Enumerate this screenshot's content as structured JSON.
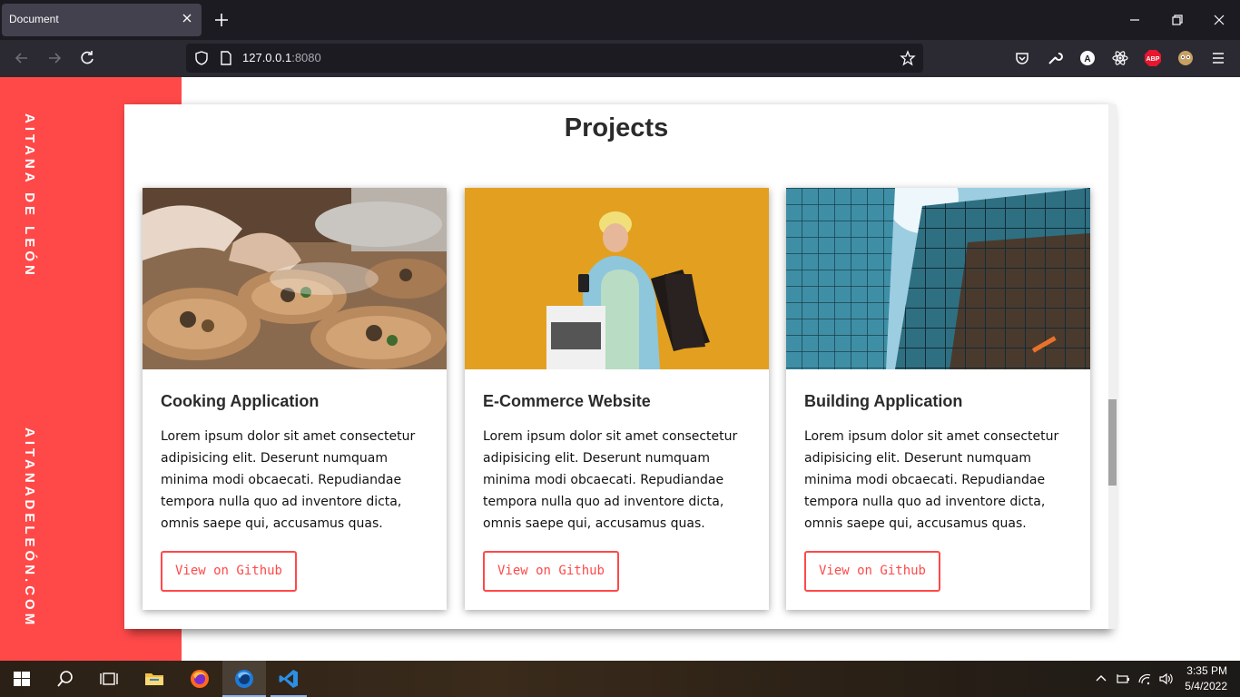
{
  "browser": {
    "tab_title": "Document",
    "url_host": "127.0.0.1",
    "url_port": ":8080"
  },
  "sidebar": {
    "name": "AITANA DE LEÓN",
    "site": "AITANADELEÓN.COM"
  },
  "section": {
    "title": "Projects"
  },
  "projects": [
    {
      "title": "Cooking Application",
      "description": "Lorem ipsum dolor sit amet consectetur adipisicing elit. Deserunt numquam minima modi obcaecati. Repudiandae tempora nulla quo ad inventore dicta, omnis saepe qui, accusamus quas.",
      "button": "View on Github"
    },
    {
      "title": "E-Commerce Website",
      "description": "Lorem ipsum dolor sit amet consectetur adipisicing elit. Deserunt numquam minima modi obcaecati. Repudiandae tempora nulla quo ad inventore dicta, omnis saepe qui, accusamus quas.",
      "button": "View on Github"
    },
    {
      "title": "Building Application",
      "description": "Lorem ipsum dolor sit amet consectetur adipisicing elit. Deserunt numquam minima modi obcaecati. Repudiandae tempora nulla quo ad inventore dicta, omnis saepe qui, accusamus quas.",
      "button": "View on Github"
    }
  ],
  "taskbar": {
    "time": "3:35 PM",
    "date": "5/4/2022"
  },
  "colors": {
    "accent": "#ff4949",
    "chrome": "#1c1b22"
  }
}
